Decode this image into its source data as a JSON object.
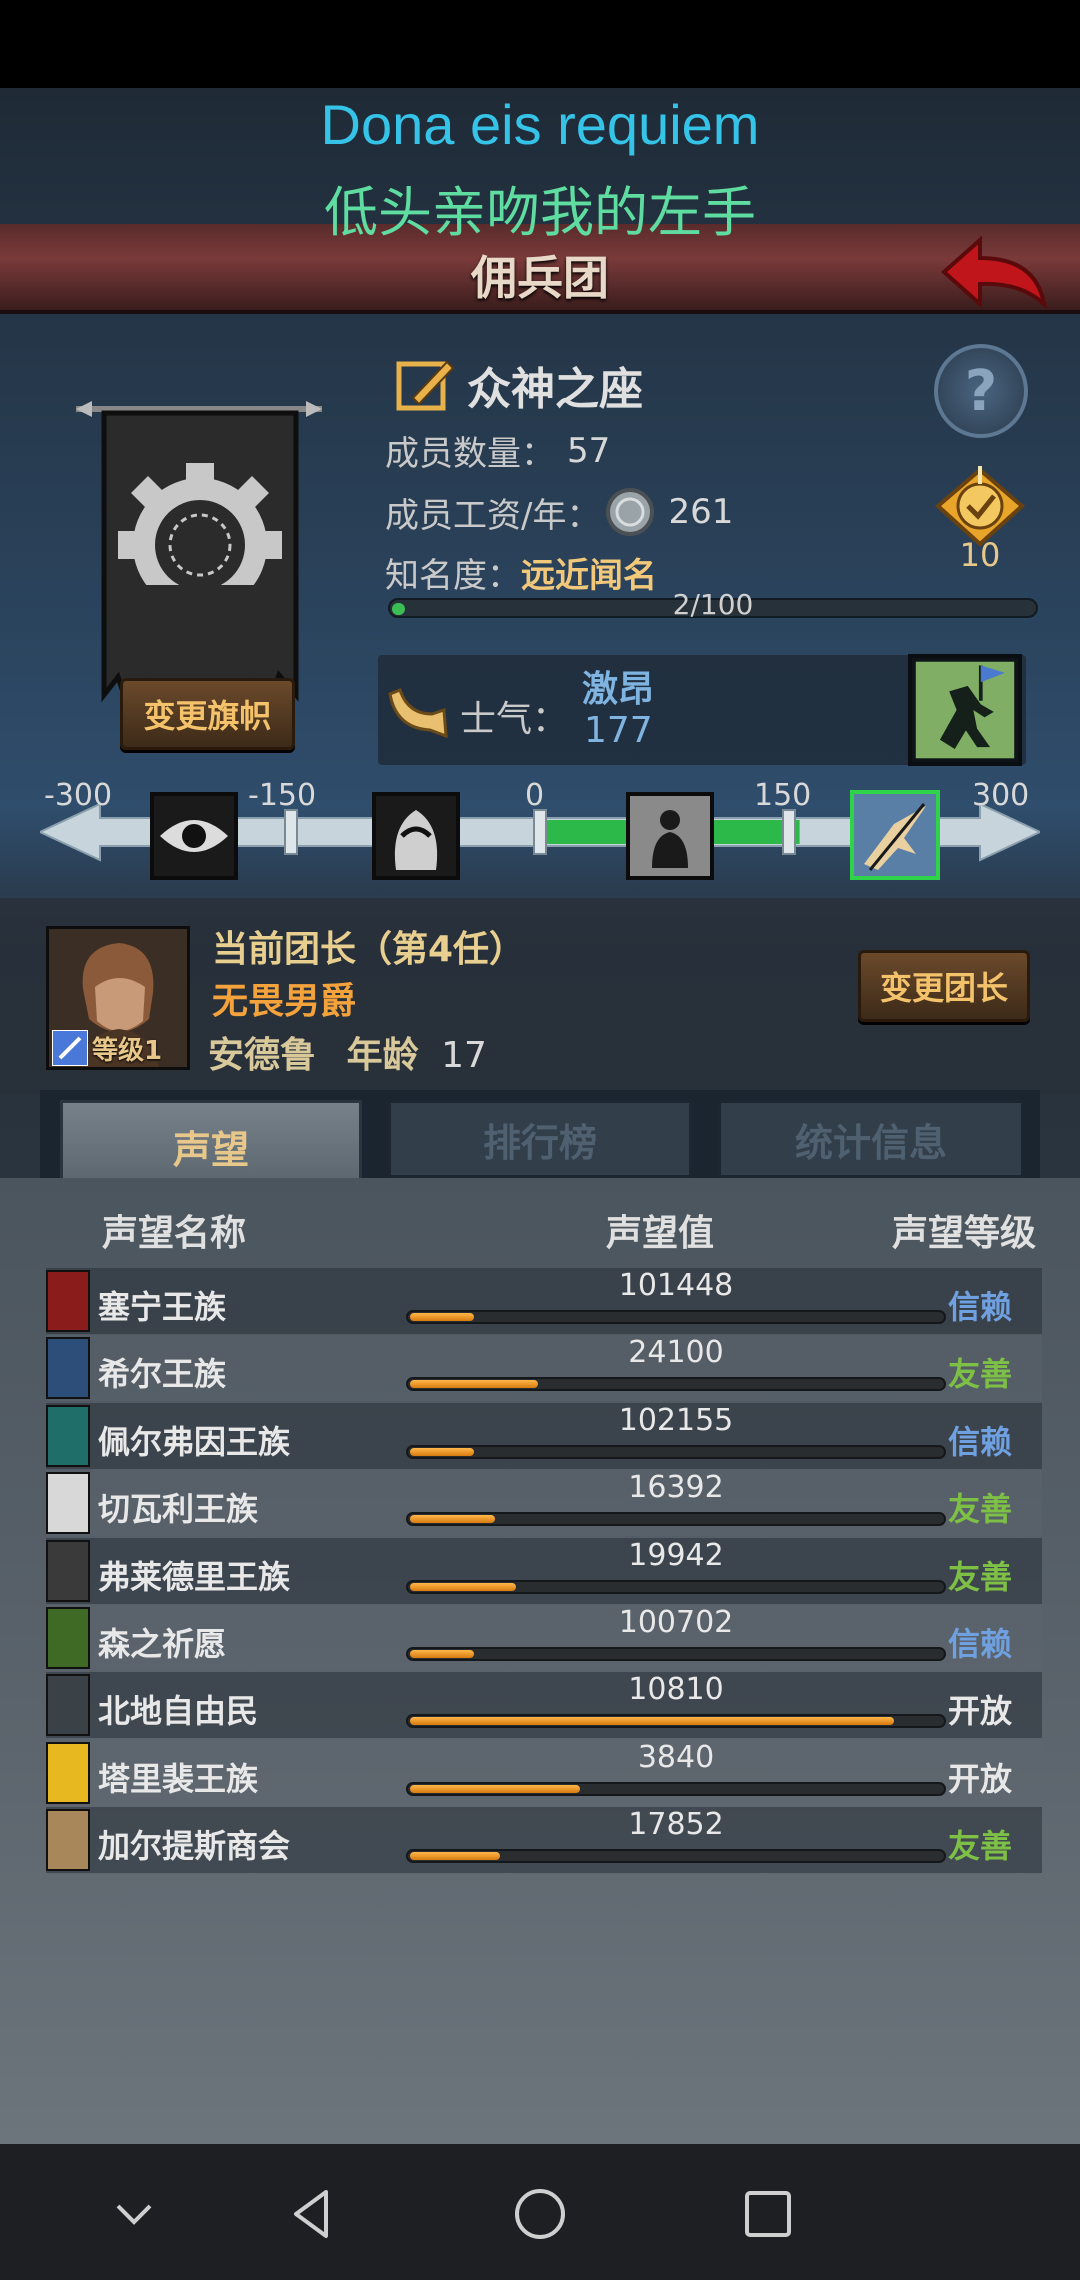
{
  "overlay": {
    "line1": "Dona eis requiem",
    "line2": "低头亲吻我的左手"
  },
  "title": "佣兵团",
  "guild": {
    "name": "众神之座",
    "members_label": "成员数量：",
    "members_value": "57",
    "wage_label": "成员工资/年：",
    "wage_value": "261",
    "fame_label": "知名度：",
    "fame_value": "远近闻名",
    "fame_progress": "2/100",
    "fame_fraction": 0.02,
    "badge_count": "10",
    "change_flag_button": "变更旗帜",
    "help_glyph": "?"
  },
  "morale": {
    "label": "士气：",
    "state": "激昂",
    "value": "177",
    "scale_labels": [
      "-300",
      "-150",
      "0",
      "150",
      "300"
    ],
    "min": -300,
    "max": 300,
    "current": 177
  },
  "commander": {
    "title": "当前团长（第4任）",
    "name": "无畏男爵",
    "level_label": "等级1",
    "person": "安德鲁",
    "age_label": "年龄",
    "age_value": "17",
    "change_button": "变更团长"
  },
  "tabs": [
    {
      "label": "声望",
      "active": true
    },
    {
      "label": "排行榜",
      "active": false
    },
    {
      "label": "统计信息",
      "active": false
    }
  ],
  "table": {
    "headers": {
      "name": "声望名称",
      "value": "声望值",
      "level": "声望等级"
    },
    "rows": [
      {
        "name": "塞宁王族",
        "value": "101448",
        "fraction": 0.12,
        "level": "信赖",
        "level_color": "#6fa0e0",
        "icon_color": "#8b1c1c"
      },
      {
        "name": "希尔王族",
        "value": "24100",
        "fraction": 0.24,
        "level": "友善",
        "level_color": "#7ec045",
        "icon_color": "#2c4e78"
      },
      {
        "name": "佩尔弗因王族",
        "value": "102155",
        "fraction": 0.12,
        "level": "信赖",
        "level_color": "#6fa0e0",
        "icon_color": "#1f6e6a"
      },
      {
        "name": "切瓦利王族",
        "value": "16392",
        "fraction": 0.16,
        "level": "友善",
        "level_color": "#7ec045",
        "icon_color": "#d8d8d8"
      },
      {
        "name": "弗莱德里王族",
        "value": "19942",
        "fraction": 0.2,
        "level": "友善",
        "level_color": "#7ec045",
        "icon_color": "#3a3a3a"
      },
      {
        "name": "森之祈愿",
        "value": "100702",
        "fraction": 0.12,
        "level": "信赖",
        "level_color": "#6fa0e0",
        "icon_color": "#3f6a26"
      },
      {
        "name": "北地自由民",
        "value": "10810",
        "fraction": 0.91,
        "level": "开放",
        "level_color": "#e8e8e8",
        "icon_color": "#3a4248"
      },
      {
        "name": "塔里裴王族",
        "value": "3840",
        "fraction": 0.32,
        "level": "开放",
        "level_color": "#e8e8e8",
        "icon_color": "#e8b820"
      },
      {
        "name": "加尔提斯商会",
        "value": "17852",
        "fraction": 0.17,
        "level": "友善",
        "level_color": "#7ec045",
        "icon_color": "#a8885a"
      }
    ]
  },
  "colors": {
    "fame_bar": "#3bbf55",
    "morale_bar": "#2db84a",
    "rep_bar": "#e89a2a"
  },
  "icons": [
    "back-arrow-icon",
    "quill-icon",
    "silver-coin-icon",
    "help-icon",
    "achievement-badge-icon",
    "horn-icon",
    "morale-flag-icon",
    "eye-icon",
    "despair-icon",
    "calm-icon",
    "charge-icon",
    "sword-icon",
    "nav-hide-icon",
    "nav-back-icon",
    "nav-home-icon",
    "nav-recent-icon"
  ]
}
